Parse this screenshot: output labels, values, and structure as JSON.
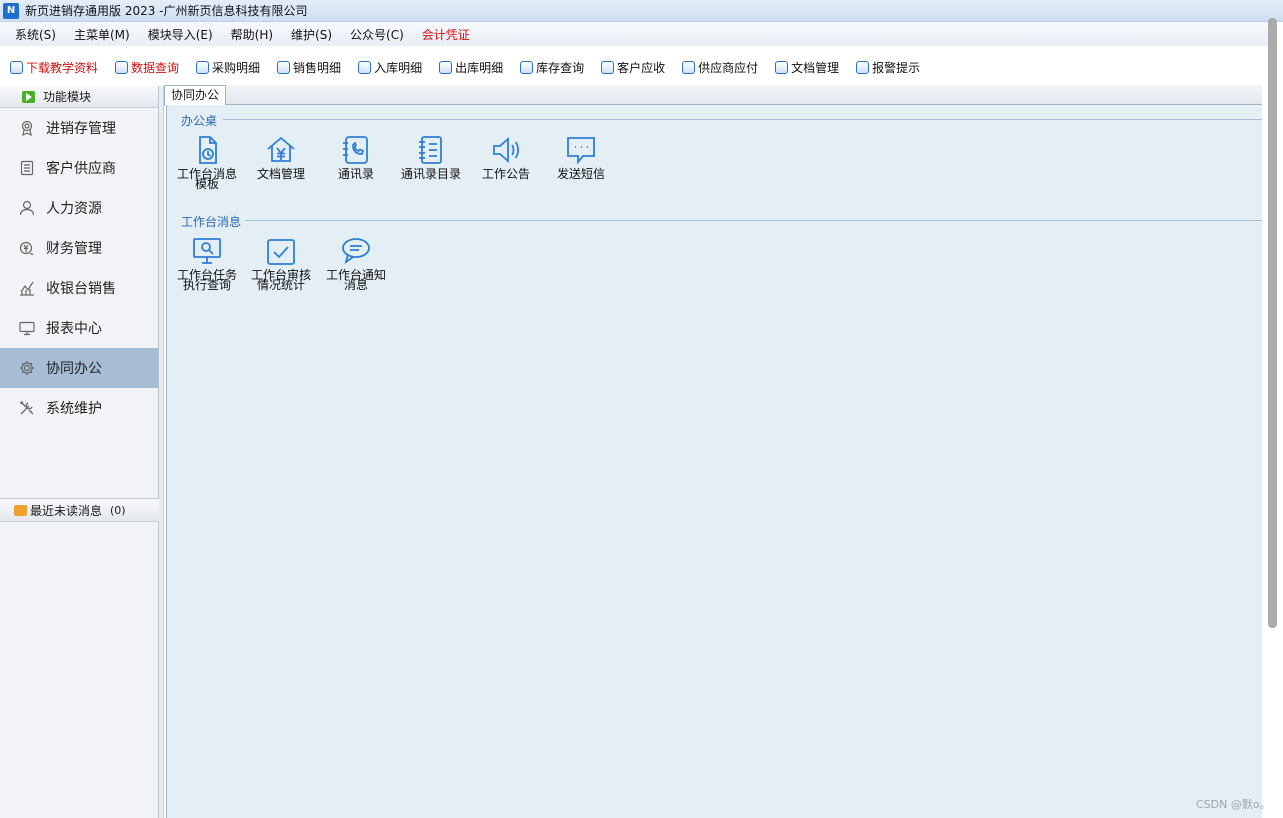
{
  "window": {
    "title": "新页进销存通用版 2023 -广州新页信息科技有限公司"
  },
  "menubar": [
    {
      "label": "系统(S)"
    },
    {
      "label": "主菜单(M)"
    },
    {
      "label": "模块导入(E)"
    },
    {
      "label": "帮助(H)"
    },
    {
      "label": "维护(S)"
    },
    {
      "label": "公众号(C)"
    },
    {
      "label": "会计凭证",
      "color": "#d01010"
    }
  ],
  "toolbar": [
    {
      "label": "下载教学资料",
      "color": "#d01010"
    },
    {
      "label": "数据查询",
      "color": "#d01010"
    },
    {
      "label": "采购明细"
    },
    {
      "label": "销售明细"
    },
    {
      "label": "入库明细"
    },
    {
      "label": "出库明细"
    },
    {
      "label": "库存查询"
    },
    {
      "label": "客户应收"
    },
    {
      "label": "供应商应付"
    },
    {
      "label": "文档管理"
    },
    {
      "label": "报警提示"
    }
  ],
  "sidebar": {
    "header": "功能模块",
    "items": [
      {
        "label": "进销存管理",
        "icon": "medal-icon"
      },
      {
        "label": "客户供应商",
        "icon": "clipboard-icon"
      },
      {
        "label": "人力资源",
        "icon": "person-icon"
      },
      {
        "label": "财务管理",
        "icon": "money-icon"
      },
      {
        "label": "收银台销售",
        "icon": "chart-icon"
      },
      {
        "label": "报表中心",
        "icon": "monitor-icon"
      },
      {
        "label": "协同办公",
        "icon": "gear-icon",
        "active": true
      },
      {
        "label": "系统维护",
        "icon": "tools-icon"
      }
    ],
    "unread": {
      "label": "最近未读消息",
      "count": "(0)"
    }
  },
  "tabs": [
    {
      "label": "协同办公",
      "active": true
    }
  ],
  "groups": [
    {
      "title": "办公桌",
      "tiles": [
        {
          "label": "工作台消息\n模板",
          "icon": "document-clock-icon"
        },
        {
          "label": "文档管理",
          "icon": "house-yen-icon"
        },
        {
          "label": "通讯录",
          "icon": "phonebook-icon"
        },
        {
          "label": "通讯录目录",
          "icon": "notebook-list-icon"
        },
        {
          "label": "工作公告",
          "icon": "speaker-icon"
        },
        {
          "label": "发送短信",
          "icon": "chat-dots-icon"
        }
      ]
    },
    {
      "title": "工作台消息",
      "tiles": [
        {
          "label": "工作台任务\n执行查询",
          "icon": "monitor-search-icon"
        },
        {
          "label": "工作台审核\n情况统计",
          "icon": "checkbox-icon"
        },
        {
          "label": "工作台通知\n消息",
          "icon": "message-bubble-icon"
        }
      ]
    }
  ],
  "watermark": "CSDN @默o。",
  "colors": {
    "accent": "#2f7fd4",
    "active_item": "#a7bdd4",
    "content_bg": "#e4eef5",
    "warning_text": "#d01010"
  }
}
